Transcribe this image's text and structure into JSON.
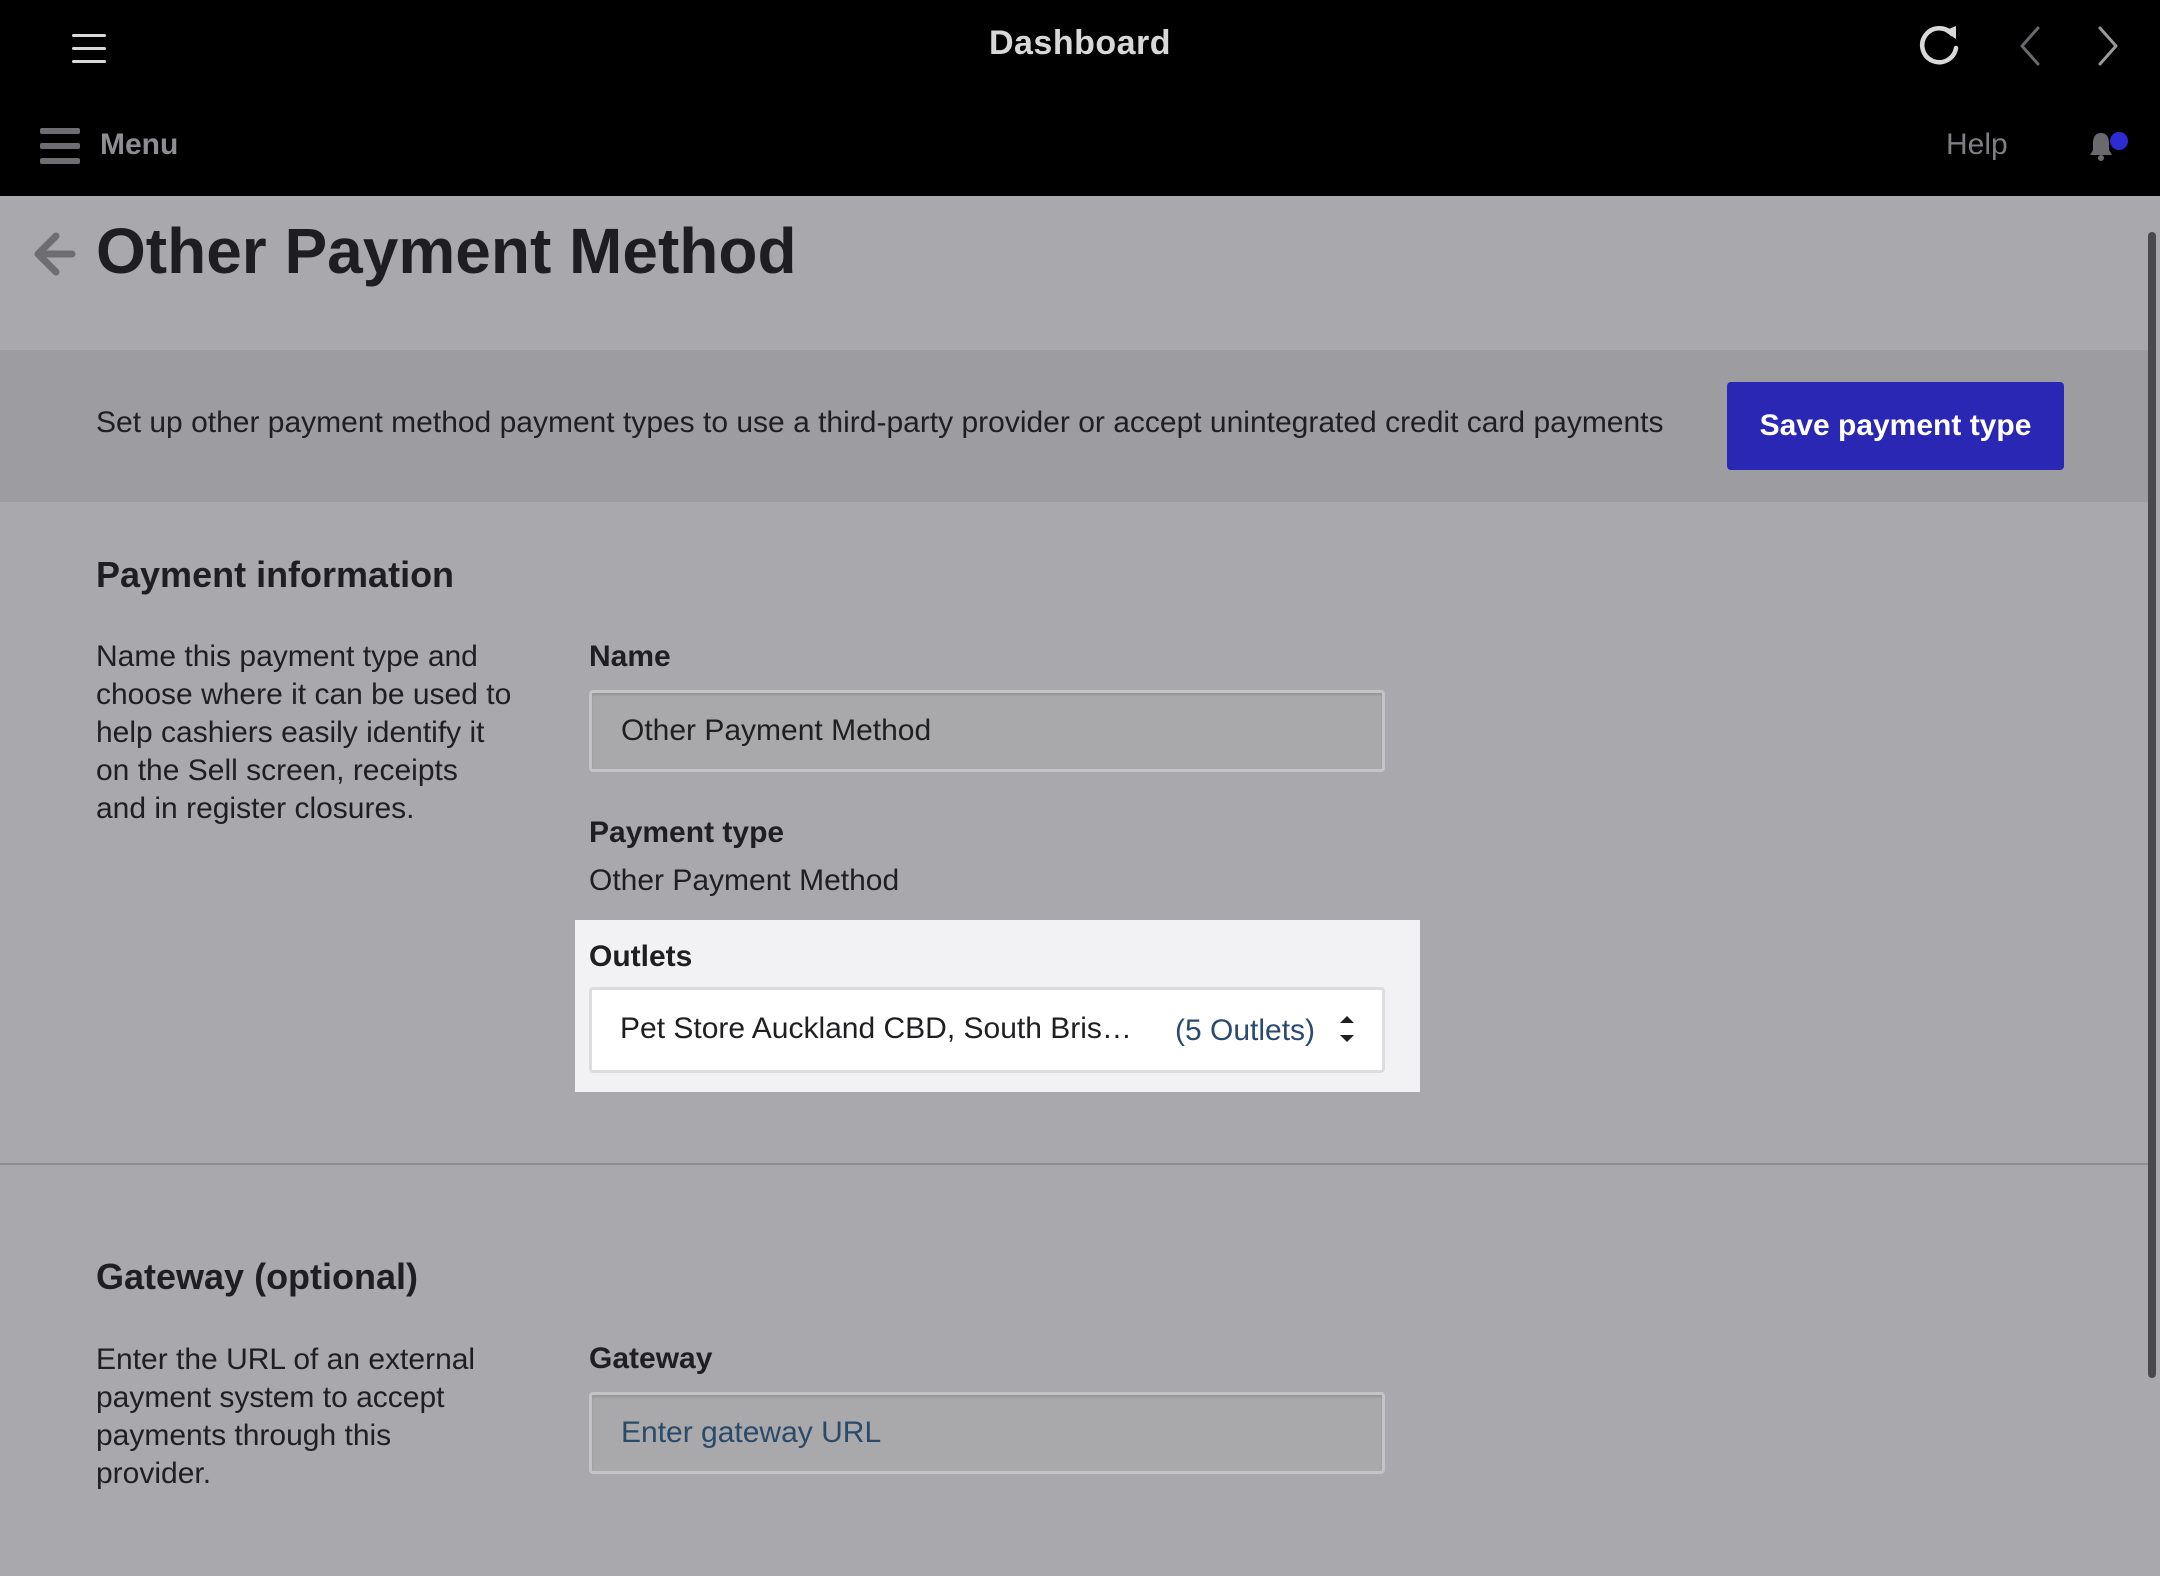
{
  "browser": {
    "title": "Dashboard"
  },
  "nav": {
    "menu_label": "Menu",
    "help_label": "Help",
    "notification_dot_color": "#2d2cd4"
  },
  "page": {
    "title": "Other Payment Method",
    "description": "Set up other payment method payment types to use a third-party provider or accept unintegrated credit card payments",
    "save_button": "Save payment type",
    "accent_color": "#2a27b5"
  },
  "payment_info": {
    "title": "Payment information",
    "description": "Name this payment type and choose where it can be used to help cashiers easily identify it on the Sell screen, receipts and in register closures.",
    "name_label": "Name",
    "name_value": "Other Payment Method",
    "payment_type_label": "Payment type",
    "payment_type_value": "Other Payment Method",
    "outlets_label": "Outlets",
    "outlets_value": "Pet Store Auckland CBD, South Brisba…",
    "outlets_count": "(5 Outlets)"
  },
  "gateway": {
    "title": "Gateway (optional)",
    "description": "Enter the URL of an external payment system to accept payments through this provider.",
    "field_label": "Gateway",
    "placeholder": "Enter gateway URL",
    "value": ""
  }
}
